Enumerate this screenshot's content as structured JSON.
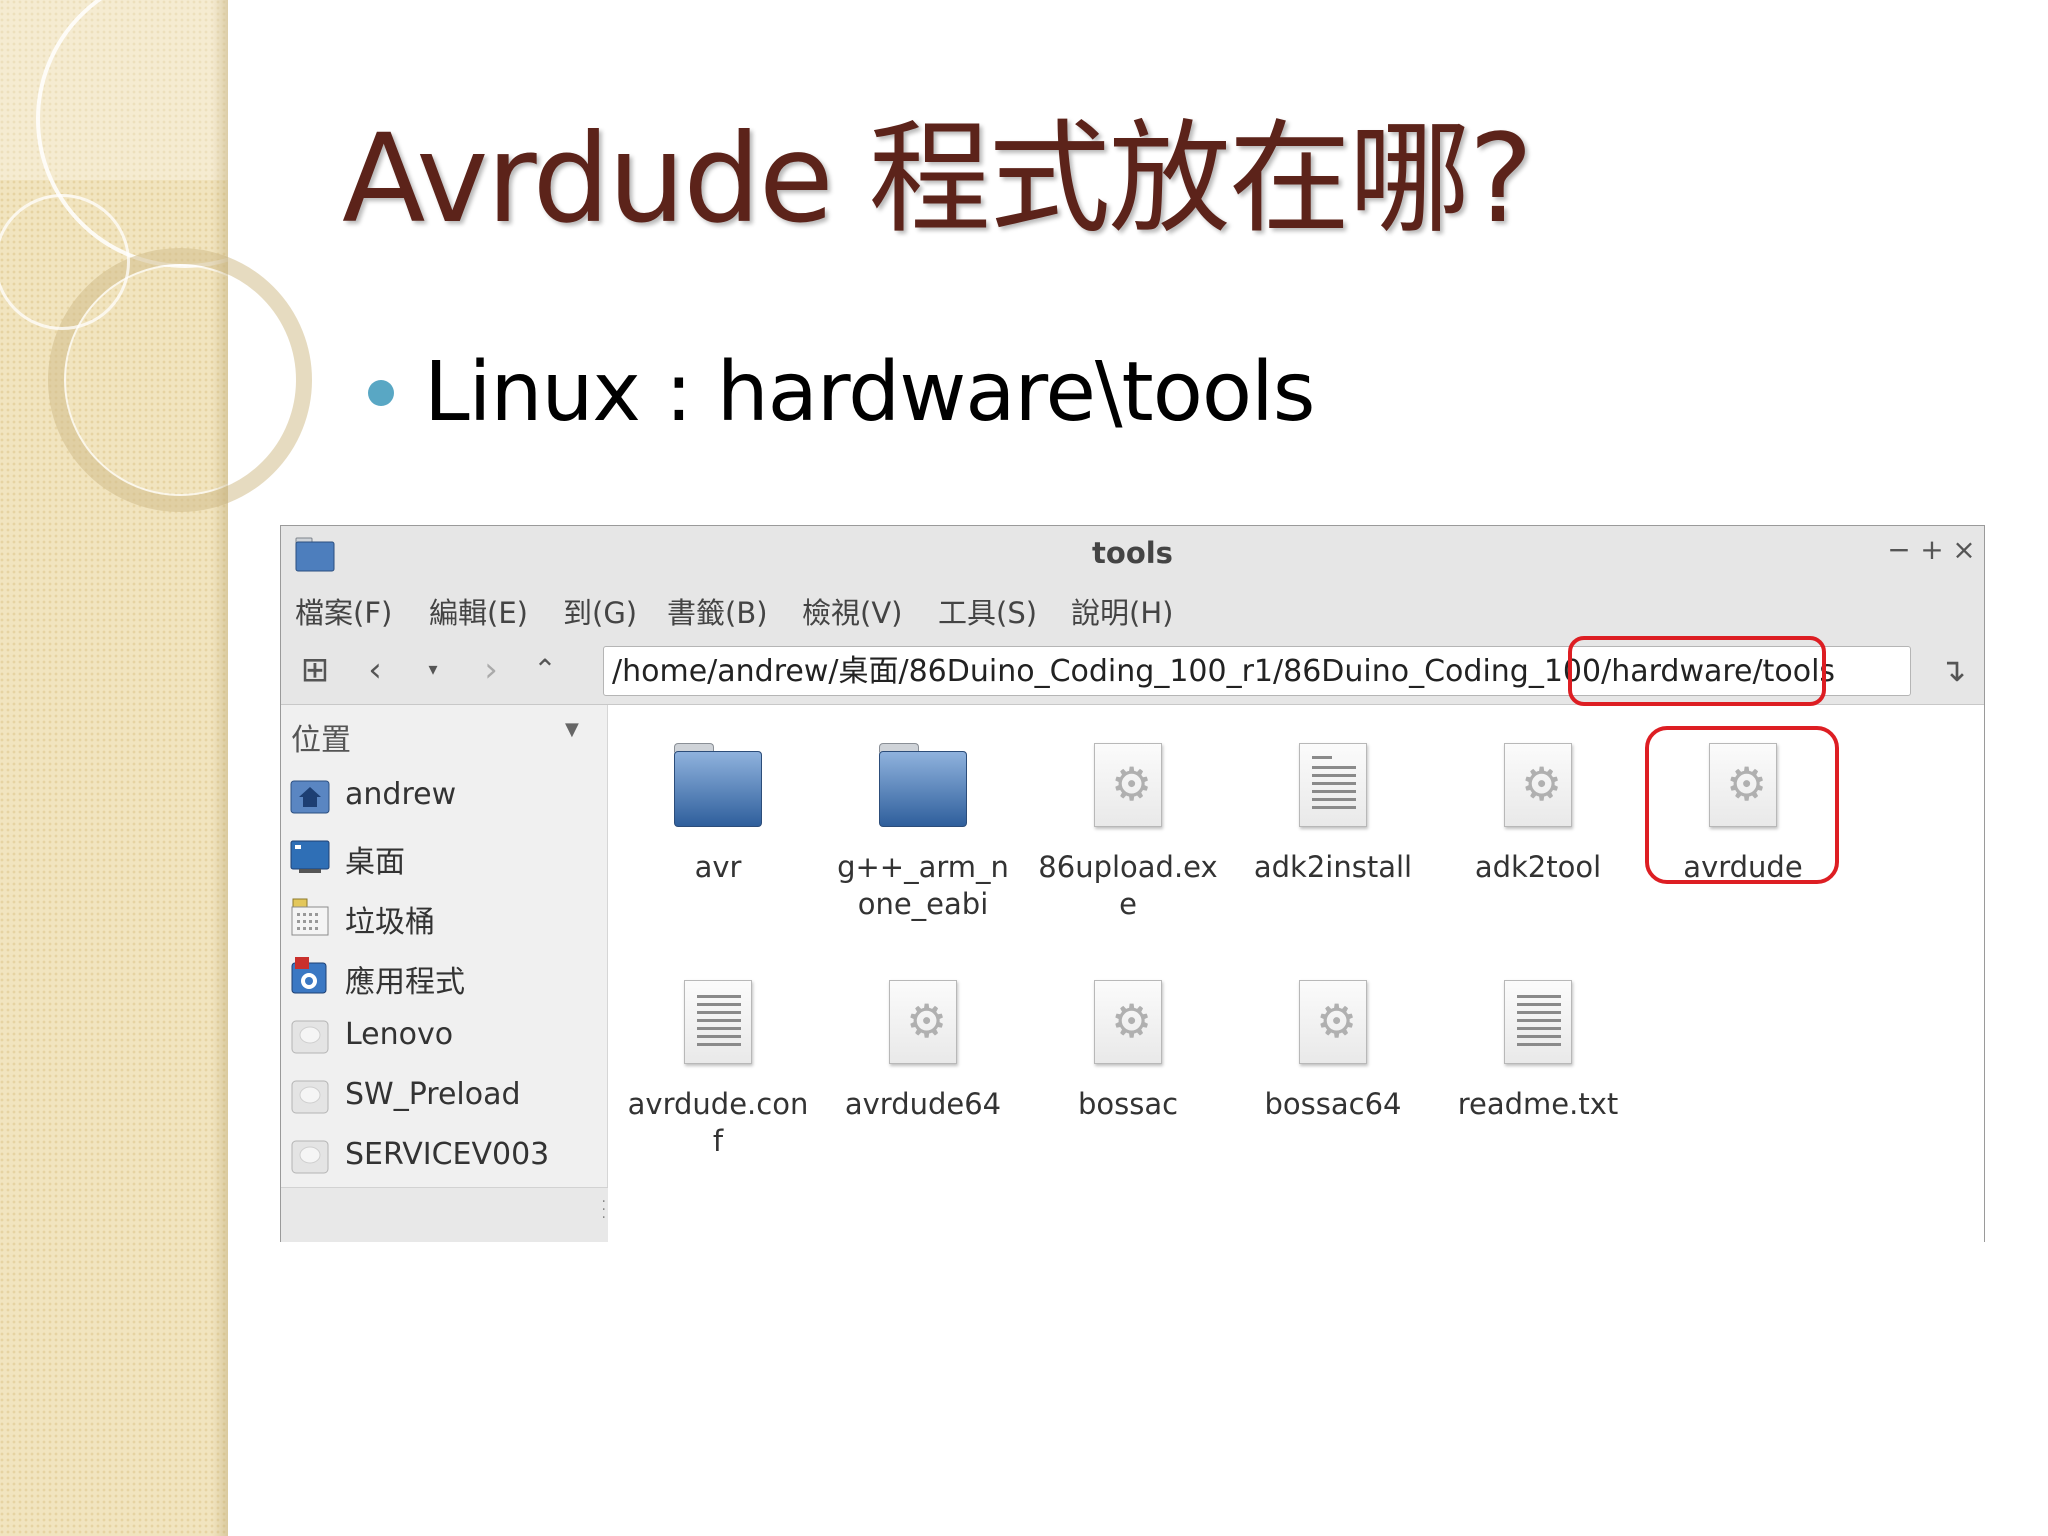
{
  "slide": {
    "title": "Avrdude 程式放在哪?",
    "bullet": "Linux : hardware\\tools"
  },
  "window": {
    "title": "tools",
    "controls": {
      "minimize": "−",
      "maximize": "+",
      "close": "×"
    },
    "menu": [
      "檔案(F)",
      "編輯(E)",
      "到(G)",
      "書籤(B)",
      "檢視(V)",
      "工具(S)",
      "說明(H)"
    ],
    "path": "/home/andrew/桌面/86Duino_Coding_100_r1/86Duino_Coding_100/hardware/tools",
    "sidebar": {
      "header": "位置",
      "places": [
        {
          "label": "andrew",
          "icon": "home-folder-icon"
        },
        {
          "label": "桌面",
          "icon": "desktop-icon"
        },
        {
          "label": "垃圾桶",
          "icon": "trash-icon"
        },
        {
          "label": "應用程式",
          "icon": "applications-icon"
        },
        {
          "label": "Lenovo",
          "icon": "drive-icon"
        },
        {
          "label": "SW_Preload",
          "icon": "drive-icon"
        },
        {
          "label": "SERVICEV003",
          "icon": "drive-icon"
        }
      ]
    },
    "files": [
      {
        "name": "avr",
        "type": "folder"
      },
      {
        "name": "g++_arm_none_eabi",
        "type": "folder"
      },
      {
        "name": "86upload.exe",
        "type": "executable"
      },
      {
        "name": "adk2install",
        "type": "script"
      },
      {
        "name": "adk2tool",
        "type": "executable"
      },
      {
        "name": "avrdude",
        "type": "executable",
        "highlighted": true
      },
      {
        "name": "avrdude.conf",
        "type": "text"
      },
      {
        "name": "avrdude64",
        "type": "executable"
      },
      {
        "name": "bossac",
        "type": "executable"
      },
      {
        "name": "bossac64",
        "type": "executable"
      },
      {
        "name": "readme.txt",
        "type": "text"
      }
    ]
  },
  "colors": {
    "title": "#5c231a",
    "bullet": "#59a7c4",
    "highlight": "#dd1e23",
    "deco": "#f1e4bf"
  }
}
